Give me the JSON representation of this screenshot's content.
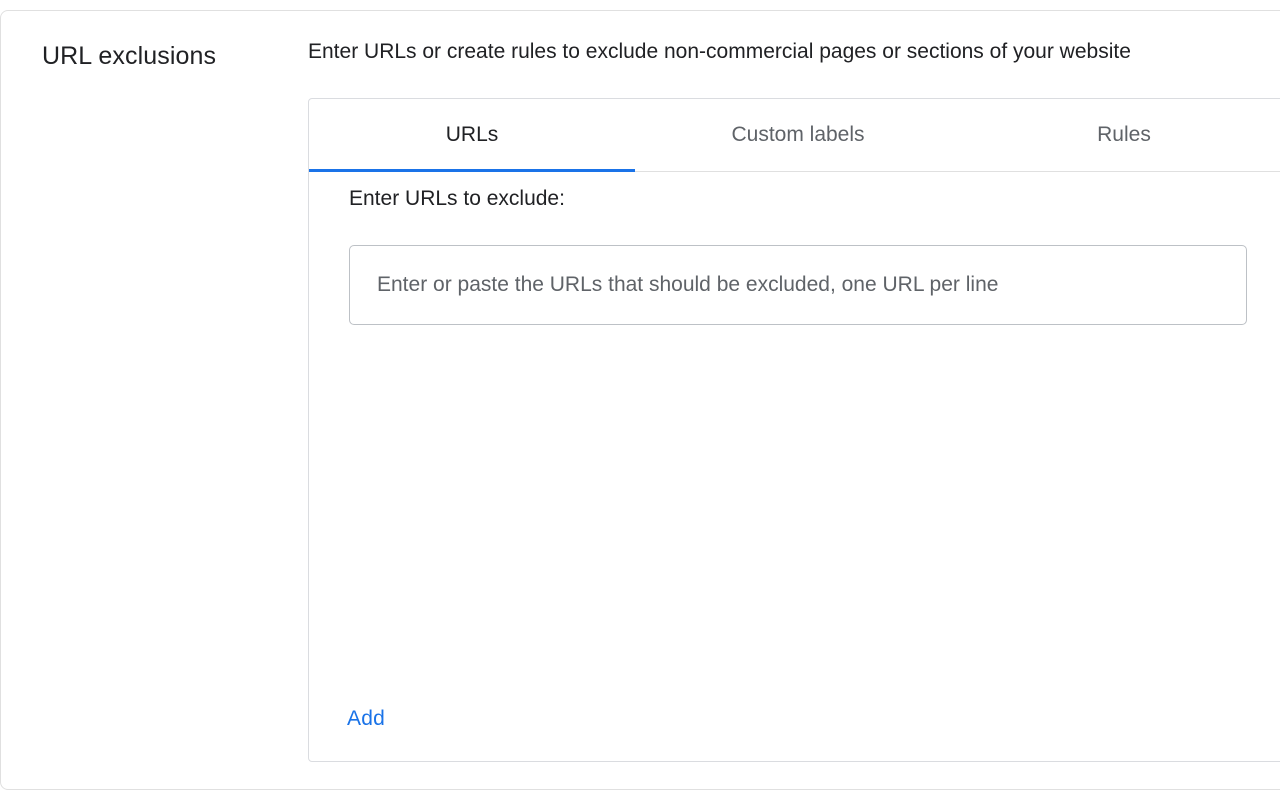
{
  "section": {
    "title": "URL exclusions",
    "description": "Enter URLs or create rules to exclude non-commercial pages or sections of your website"
  },
  "tabs": [
    {
      "label": "URLs",
      "active": true
    },
    {
      "label": "Custom labels",
      "active": false
    },
    {
      "label": "Rules",
      "active": false
    }
  ],
  "urls_tab": {
    "field_label": "Enter URLs to exclude:",
    "input_value": "",
    "input_placeholder": "Enter or paste the URLs that should be excluded, one URL per line",
    "add_label": "Add"
  },
  "colors": {
    "accent": "#1a73e8",
    "text_primary": "#202124",
    "text_secondary": "#5f6368",
    "border": "#dadce0"
  }
}
